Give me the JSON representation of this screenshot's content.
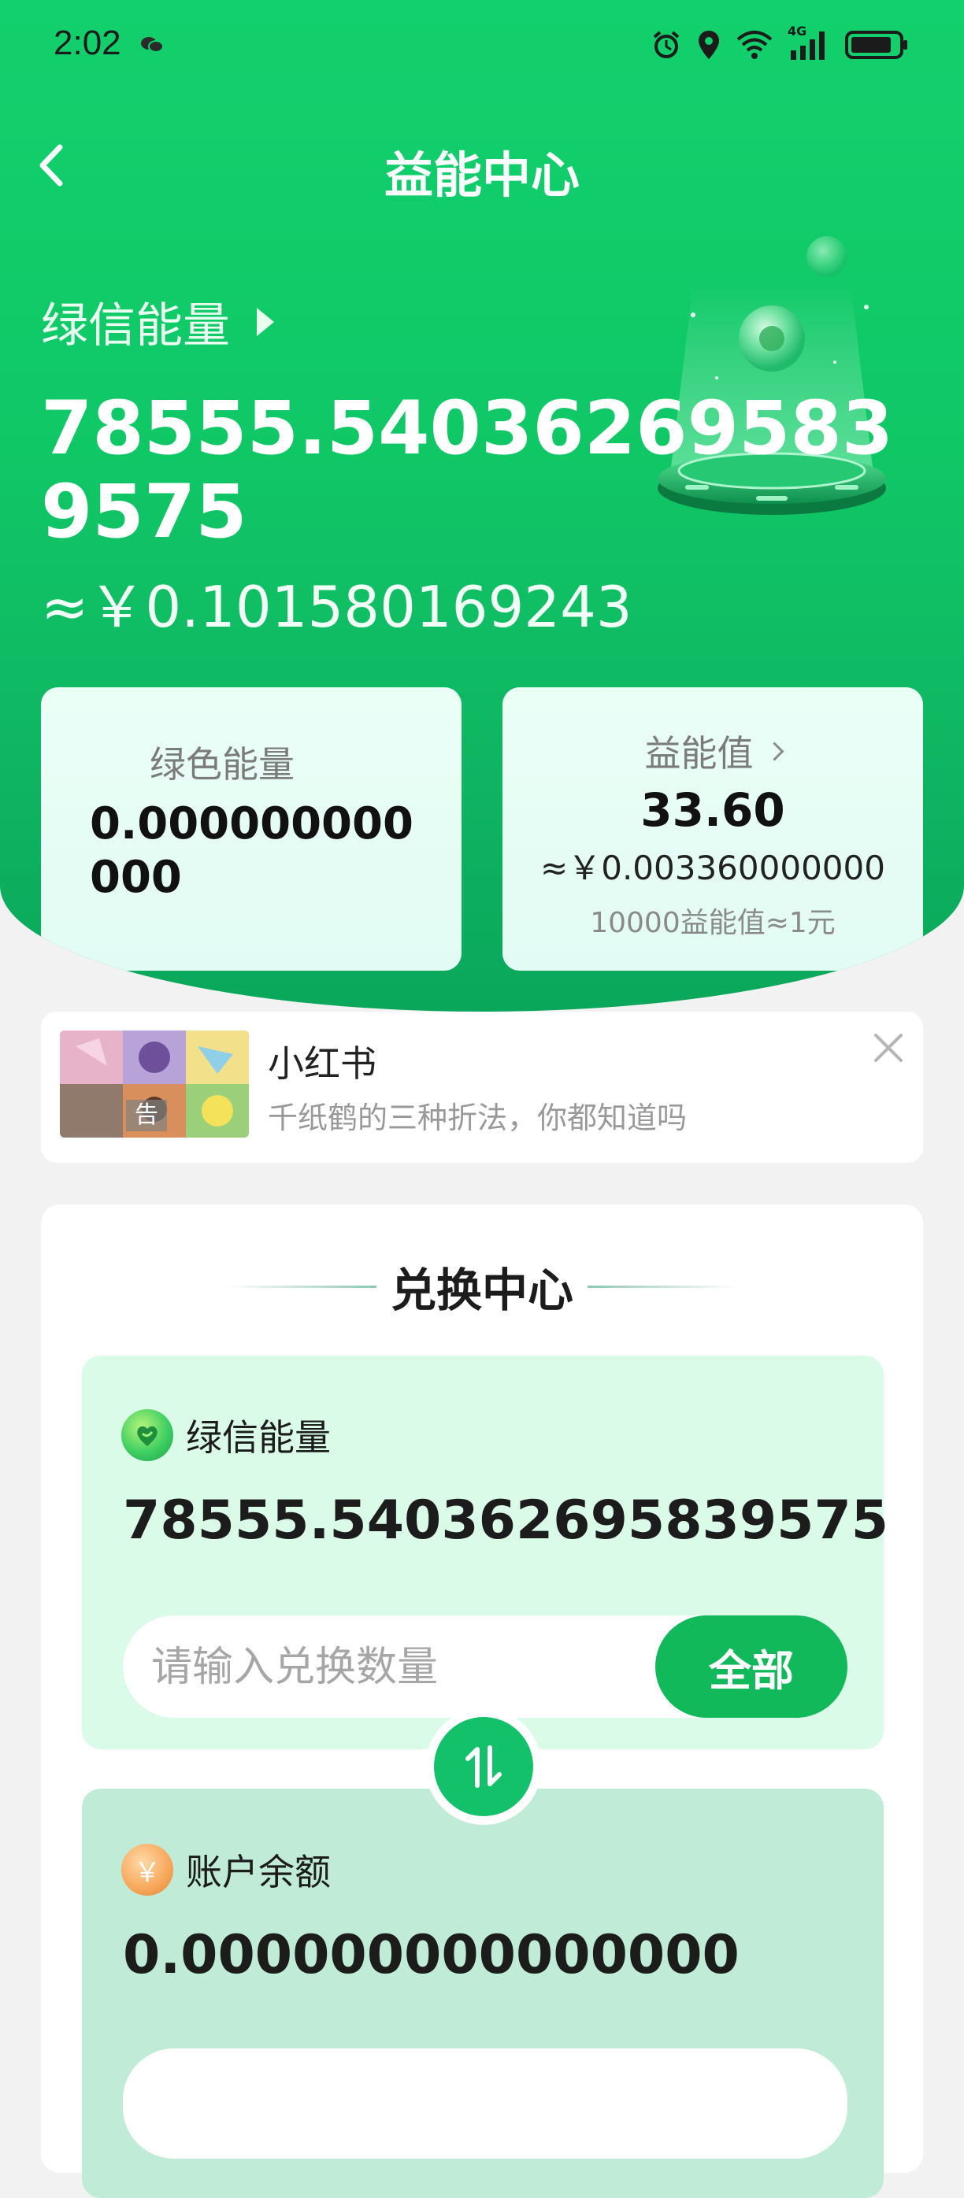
{
  "status_bar": {
    "time": "2:02",
    "network": "4G",
    "icons": [
      "wechat-icon",
      "alarm-icon",
      "location-icon",
      "wifi-icon",
      "signal-icon",
      "battery-icon"
    ]
  },
  "nav": {
    "title": "益能中心",
    "back_icon": "chevron-left-icon"
  },
  "energy": {
    "label": "绿信能量",
    "amount": "78555.540362695839575",
    "yuan": "≈￥0.101580169243"
  },
  "cards": {
    "green_energy": {
      "label": "绿色能量",
      "value": "0.000000000000"
    },
    "benefit": {
      "label": "益能值",
      "value": "33.60",
      "yuan": "≈￥0.003360000000",
      "note": "10000益能值≈1元"
    }
  },
  "ad": {
    "title": "小红书",
    "description": "千纸鹤的三种折法，你都知道吗",
    "tag": "告"
  },
  "exchange": {
    "title": "兑换中心",
    "from": {
      "label": "绿信能量",
      "amount": "78555.540362695839575",
      "placeholder": "请输入兑换数量",
      "all_button": "全部"
    },
    "to": {
      "label": "账户余额",
      "amount": "0.000000000000000",
      "coin_symbol": "￥"
    }
  },
  "colors": {
    "primary_green": "#12b95b",
    "hero_green": "#10c766",
    "card_bg": "#e6fdf5",
    "exchange_top_bg": "#d9fbe8",
    "exchange_bottom_bg": "#c0ecd7"
  }
}
